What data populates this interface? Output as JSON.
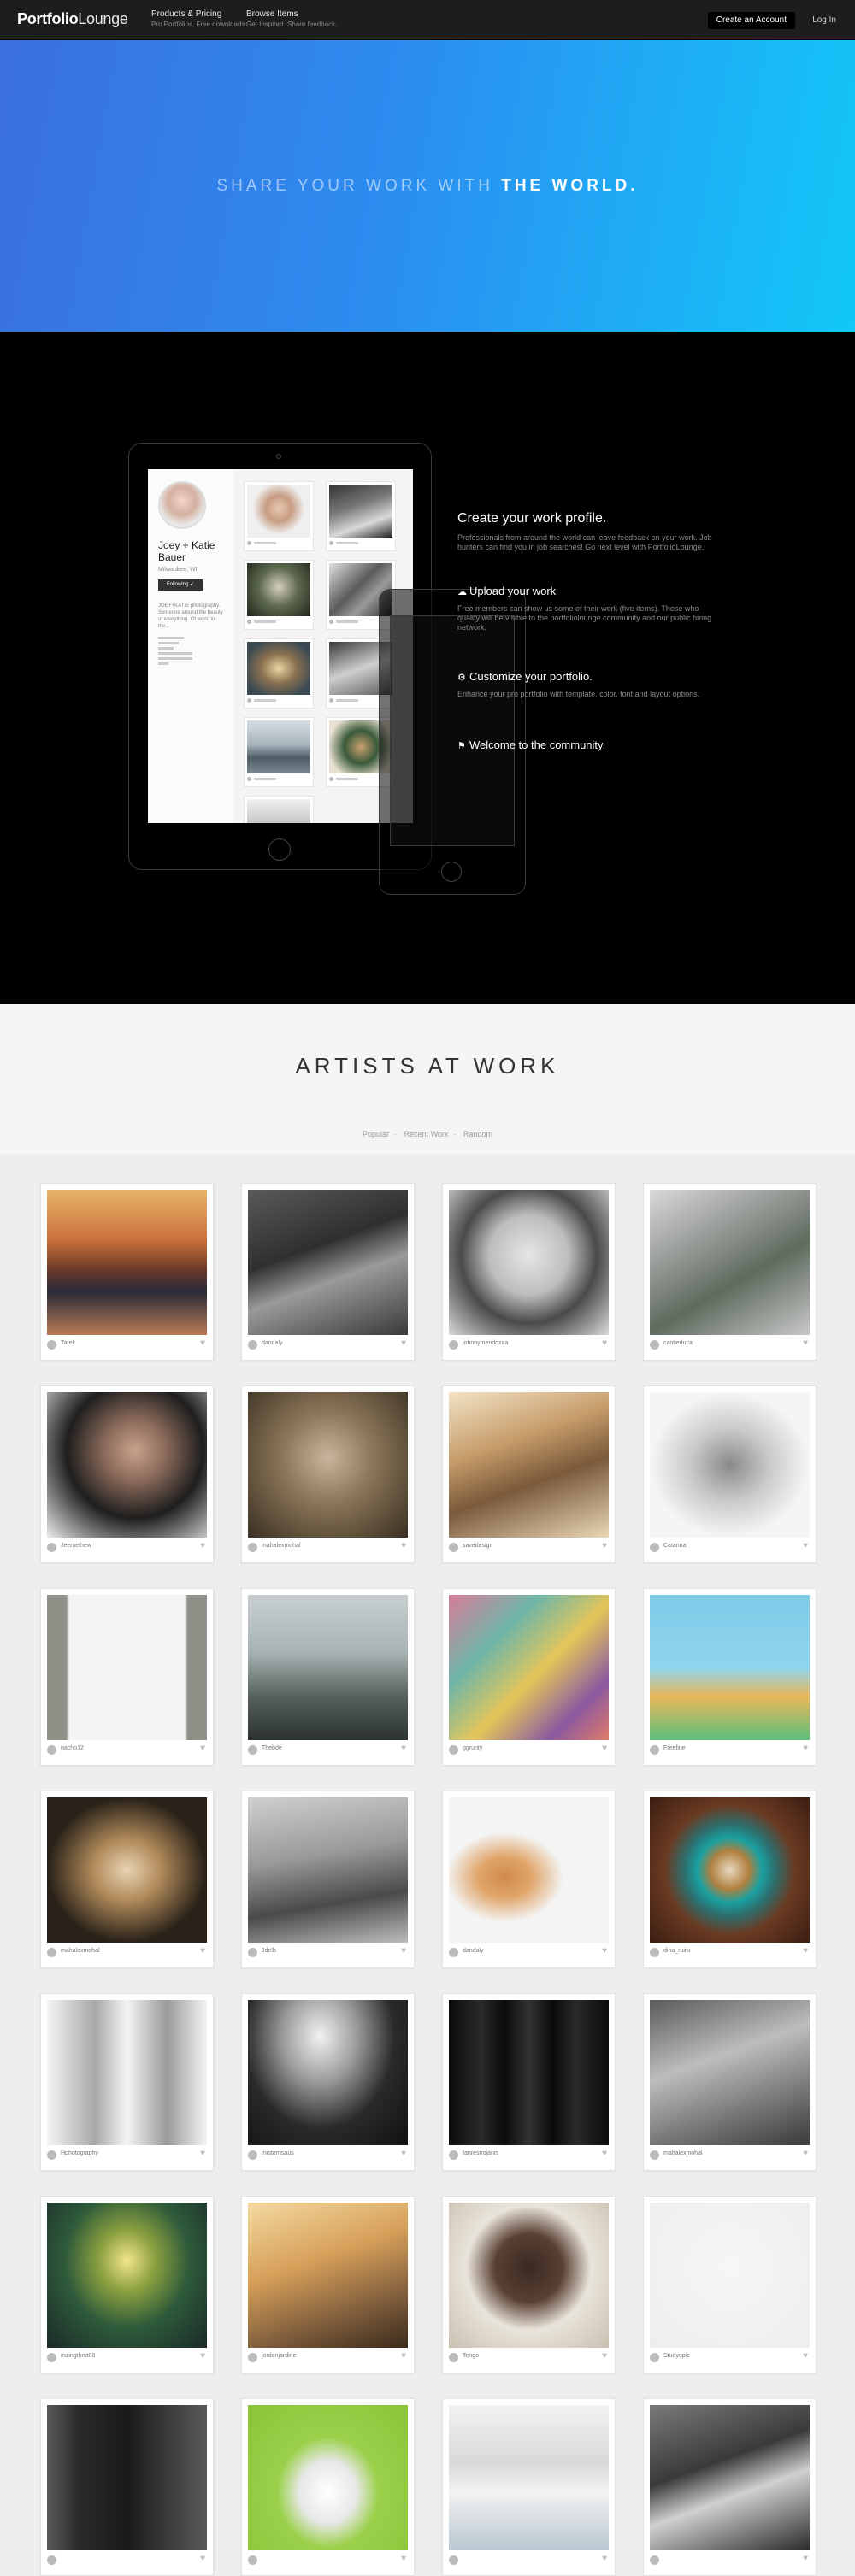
{
  "nav": {
    "logo_bold": "Portfolio",
    "logo_light": "Lounge",
    "products_title": "Products & Pricing",
    "products_sub": "Pro Portfolios, Free downloads",
    "browse_title": "Browse Items",
    "browse_sub": "Get Inspired. Share feedback.",
    "create_account": "Create an Account",
    "login": "Log In"
  },
  "hero": {
    "light": "SHARE YOUR WORK WITH",
    "bold": "THE WORLD."
  },
  "profile": {
    "name": "Joey + Katie Bauer",
    "location": "Milwaukee, WI",
    "follow": "Following ✓",
    "bio": "JOEY+KATIE photography. Someone around the beauty of everything. Of world in the..."
  },
  "features": {
    "h1": "Create your work profile.",
    "p1": "Professionals from around the world can leave feedback on your work. Job hunters can find you in job searches! Go next level with PortfolioLounge.",
    "h2": "Upload your work",
    "p2": "Free members can show us some of their work (five items). Those who qualify will be visible to the portfoliolounge community and our public hiring network.",
    "h3": "Customize your portfolio.",
    "p3": "Enhance your pro portfolio with template, color, font and layout options.",
    "h4": "Welcome to the community.",
    "icon2": "cloud-upload-icon",
    "icon3": "gear-icon",
    "icon4": "flag-icon"
  },
  "artists": {
    "title": "ARTISTS AT WORK",
    "filters": [
      "Popular",
      "Recent Work",
      "Random"
    ]
  },
  "cards": [
    {
      "user": "Tarek",
      "bg": "linear-gradient(180deg,#e7b46a 0%,#c9703a 35%,#6b3a28 55%,#2a2a38 70%,#b87a55 100%)"
    },
    {
      "user": "dandaly",
      "bg": "linear-gradient(160deg,#5a5a5a 0%,#2f2f2f 40%,#9a9a9a 60%,#3a3a3a 100%)"
    },
    {
      "user": "johnnymendozaa",
      "bg": "radial-gradient(ellipse at 50% 45%,#e6e6e6 0%,#bdbdbd 35%,#4a4a4a 60%,#dadada 100%)"
    },
    {
      "user": "cantieduca",
      "bg": "linear-gradient(150deg,#d9d9d9 0%,#8a8f8a 40%,#5e6b5e 60%,#c8c8c8 100%)"
    },
    {
      "user": "Jeemethew",
      "bg": "radial-gradient(ellipse at 55% 40%,#c9a28c 0%,#8a6a5a 25%,#1e1e1e 55%,#ededed 100%)"
    },
    {
      "user": "mahalexmohal",
      "bg": "radial-gradient(ellipse at 50% 45%,#c9b59c 0%,#8b7658 40%,#3a2f22 100%)"
    },
    {
      "user": "savedesign",
      "bg": "linear-gradient(160deg,#f2e3c5 0%,#c69c6a 35%,#7a5a3a 60%,#e8d7b8 100%)"
    },
    {
      "user": "Catarina",
      "bg": "radial-gradient(ellipse at 50% 50%,#8a8a8a 0%,#c9c9c9 35%,#f5f5f5 70%)"
    },
    {
      "user": "nacho12",
      "bg": "linear-gradient(90deg,#8f9088 0%,#8f9088 12%,#f4f4f4 14%,#f4f4f4 86%,#8f9088 88%)"
    },
    {
      "user": "Thebde",
      "bg": "linear-gradient(180deg,#c9cfd0 0%,#a7b3b3 40%,#56605c 70%,#2c3330 100%)"
    },
    {
      "user": "ggrunty",
      "bg": "linear-gradient(135deg,#d77c9a 0%,#6eb6a8 30%,#e4c65a 55%,#8a5aa0 80%,#e07a6a 100%)"
    },
    {
      "user": "Freefine",
      "bg": "linear-gradient(180deg,#7fcbe8 0%,#8fd4ef 50%,#e9b75a 70%,#5cc07a 100%)"
    },
    {
      "user": "mahalexmohal",
      "bg": "radial-gradient(ellipse at 50% 50%,#e8d3b3 0%,#b08a5a 30%,#2a2218 70%)"
    },
    {
      "user": "Jdelh",
      "bg": "linear-gradient(170deg,#cfcfcf 0%,#9a9a9a 40%,#4a4a4a 70%,#bdbdbd 100%)"
    },
    {
      "user": "dandaly",
      "bg": "radial-gradient(ellipse at 35% 55%,#d18a4a 0%,#e0a56a 18%,#f4f4f4 40%)"
    },
    {
      "user": "dina_ruiru",
      "bg": "radial-gradient(circle at 50% 50%,#e8d8c0 0%,#b08040 18%,#1aa0a0 30%,#2c7070 42%,#6a3a22 60%,#3a1e12 100%)"
    },
    {
      "user": "Hphotography",
      "bg": "linear-gradient(90deg,#f4f4f4 0%,#a8a8a8 30%,#f4f4f4 50%,#9a9a9a 75%,#f4f4f4 100%)"
    },
    {
      "user": "misterrisaus",
      "bg": "radial-gradient(ellipse at 45% 25%,#f2f2f2 0%,#9a9a9a 30%,#2a2a2a 60%,#111 100%)"
    },
    {
      "user": "fanrestrojanis",
      "bg": "linear-gradient(90deg,#0a0a0a 0%,#2a2a2a 20%,#0a0a0a 35%,#333 50%,#0a0a0a 65%,#2a2a2a 80%,#0a0a0a 100%)"
    },
    {
      "user": "mahalexmohal",
      "bg": "linear-gradient(160deg,#5a5a5a 0%,#bdbdbd 40%,#7a7a7a 70%,#3a3a3a 100%)"
    },
    {
      "user": "mzingthrut08",
      "bg": "radial-gradient(ellipse at 50% 40%,#f3e48a 0%,#8aa040 25%,#2e5a3a 55%,#1a2a28 100%)"
    },
    {
      "user": "jordanjardine",
      "bg": "linear-gradient(160deg,#f3d9a0 0%,#d7a05a 40%,#7a5a3a 75%,#3a2a1a 100%)"
    },
    {
      "user": "Tengo",
      "bg": "radial-gradient(ellipse at 50% 45%,#3a2a22 0%,#5a4034 30%,#e9e4da 55%,#c9c0b0 100%)"
    },
    {
      "user": "Studyopic",
      "bg": "radial-gradient(circle at 50% 45%,#f6f6f6 0%,#eeeeee 100%)"
    },
    {
      "user": "",
      "bg": "linear-gradient(90deg,#5a5a5a 0%,#2a2a2a 20%,#1a1a1a 50%,#5a5a5a 100%)"
    },
    {
      "user": "",
      "bg": "radial-gradient(ellipse at 50% 60%,#ffffff 0%,#e8e8e8 25%,#9ad04a 45%,#8ac43a 100%)"
    },
    {
      "user": "",
      "bg": "linear-gradient(180deg,#f2f2f2 0%,#d9d9d9 40%,#f2f2f2 60%,#b9c7d0 100%)"
    },
    {
      "user": "",
      "bg": "linear-gradient(160deg,#7a7a7a 0%,#3a3a3a 40%,#d0d0d0 60%,#2a2a2a 100%)"
    }
  ],
  "colors": {
    "hero_start": "#3b6fe0",
    "hero_end": "#12c8f8",
    "nav_bg": "#1d1d1d",
    "feature_bg": "#000000",
    "card_bg": "#ffffff"
  }
}
